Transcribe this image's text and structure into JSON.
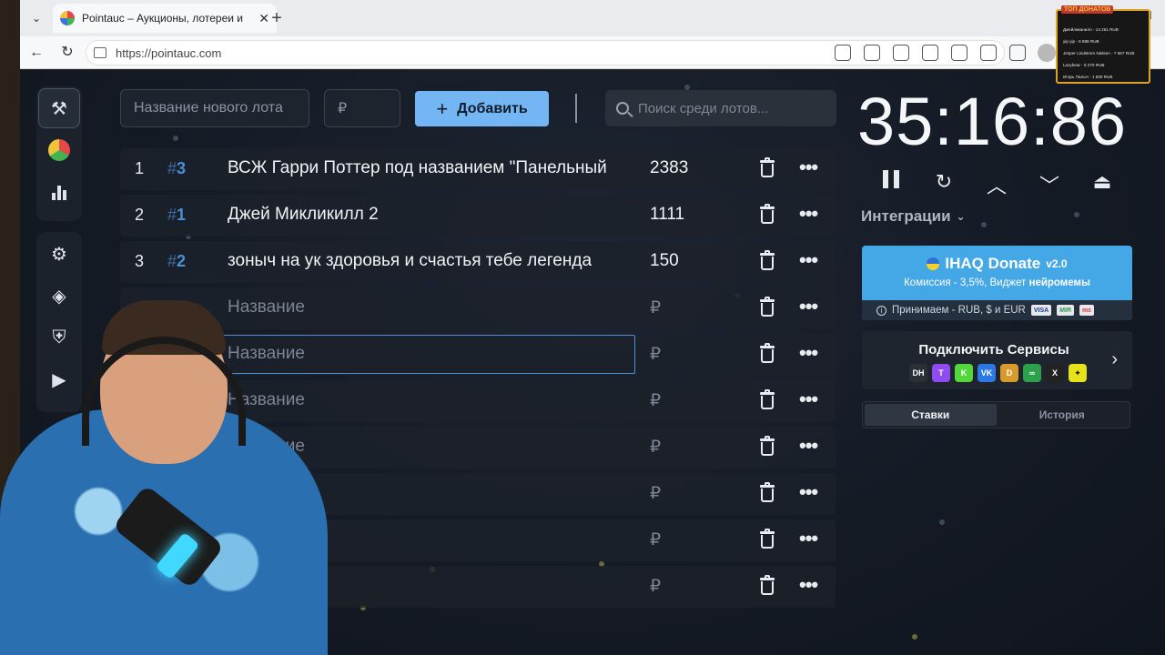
{
  "browser": {
    "tab_title": "Pointauc – Аукционы, лотереи и",
    "url": "https://pointauc.com"
  },
  "toolbar": {
    "new_lot_placeholder": "Название нового лота",
    "price_placeholder": "₽",
    "add_label": "Добавить",
    "search_placeholder": "Поиск среди лотов..."
  },
  "lots": [
    {
      "num": "1",
      "id": "3",
      "name": "ВСЖ Гарри Поттер под названием \"Панельный",
      "price": "2383"
    },
    {
      "num": "2",
      "id": "1",
      "name": "Джей Микликилл 2",
      "price": "1111"
    },
    {
      "num": "3",
      "id": "2",
      "name": "зоныч на ук здоровья и счастья тебе легенда",
      "price": "150"
    },
    {
      "num": "",
      "id": "",
      "name": "Название",
      "price": "₽"
    },
    {
      "num": "",
      "id": "",
      "name": "Название",
      "price": "₽"
    },
    {
      "num": "",
      "id": "",
      "name": "Название",
      "price": "₽"
    },
    {
      "num": "",
      "id": "",
      "name": "Название",
      "price": "₽"
    },
    {
      "num": "",
      "id": "",
      "name": "Название",
      "price": "₽"
    },
    {
      "num": "",
      "id": "",
      "name": "",
      "price": "₽"
    },
    {
      "num": "",
      "id": "",
      "name": "",
      "price": "₽"
    }
  ],
  "timer": {
    "value": "35:16:86"
  },
  "integrations_label": "Интеграции",
  "donate": {
    "title": "IHAQ Donate",
    "version": "v2.0",
    "commission_prefix": "Комиссия - 3,5%, Виджет",
    "commission_bold": "нейромемы",
    "accept": "Принимаем - RUB, $ и EUR",
    "badges": [
      "VISA",
      "MIR",
      "mc"
    ]
  },
  "services": {
    "title": "Подключить Сервисы",
    "icons": [
      {
        "label": "DH",
        "color": "#2b2f36"
      },
      {
        "label": "T",
        "color": "#8f4bf0"
      },
      {
        "label": "K",
        "color": "#53d73a"
      },
      {
        "label": "VK",
        "color": "#2c79e6"
      },
      {
        "label": "D",
        "color": "#d89a2a"
      },
      {
        "label": "∞",
        "color": "#2ca04a"
      },
      {
        "label": "X",
        "color": "#222222"
      },
      {
        "label": "✦",
        "color": "#e6e21c"
      }
    ]
  },
  "bid_tabs": {
    "bids": "Ставки",
    "history": "История"
  },
  "overlay": {
    "logo": "ТОП ДОНАТОВ",
    "rows": [
      "Джейликанилл - 14 261 RUB",
      "yip yip - 8 888 RUB",
      "Jesper Lindstrom Nielsen - 7 567 RUB",
      "Lazybear - 6 270 RUB",
      "Игорь Палыч - 1 600 RUB"
    ]
  },
  "colors": {
    "accent": "#74b6f4",
    "lot_id": "#4a90d9",
    "donate_bg": "#45a8e6"
  }
}
